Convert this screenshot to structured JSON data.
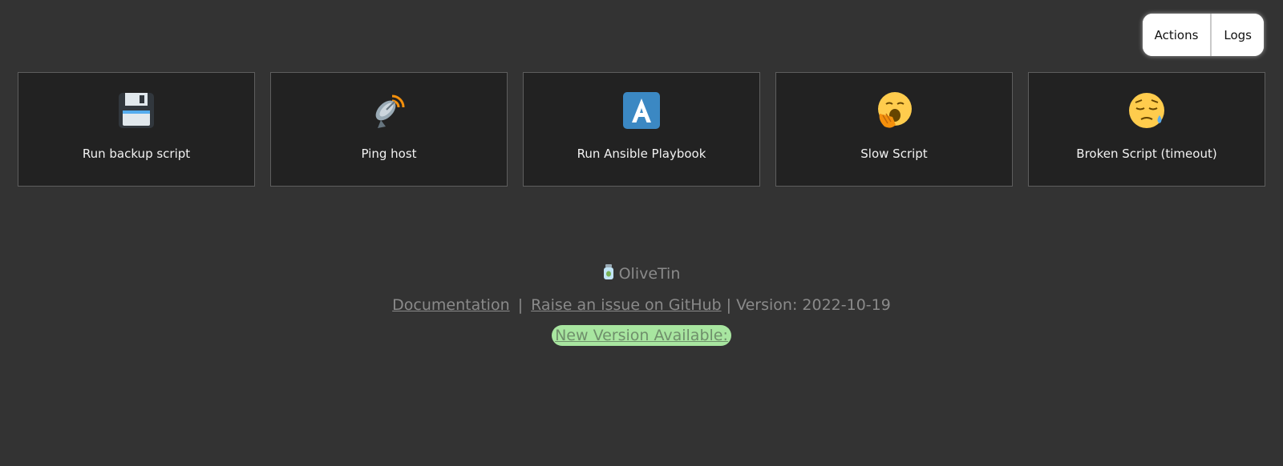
{
  "nav": {
    "actions_label": "Actions",
    "logs_label": "Logs"
  },
  "actions": [
    {
      "title": "Run backup script",
      "icon": "floppy-disk-icon"
    },
    {
      "title": "Ping host",
      "icon": "satellite-antenna-icon"
    },
    {
      "title": "Run Ansible Playbook",
      "icon": "ansible-a-icon"
    },
    {
      "title": "Slow Script",
      "icon": "yawning-face-icon"
    },
    {
      "title": "Broken Script (timeout)",
      "icon": "sleepy-face-icon"
    }
  ],
  "footer": {
    "brand": "OliveTin",
    "brand_icon": "olive-jar-icon",
    "docs_link": "Documentation",
    "separator": "|",
    "issue_link": "Raise an issue on GitHub",
    "version_text": "| Version: 2022-10-19",
    "update_text": "New Version Available:"
  },
  "colors": {
    "background": "#333333",
    "card": "#222222",
    "update_badge": "#a8e6a0"
  }
}
